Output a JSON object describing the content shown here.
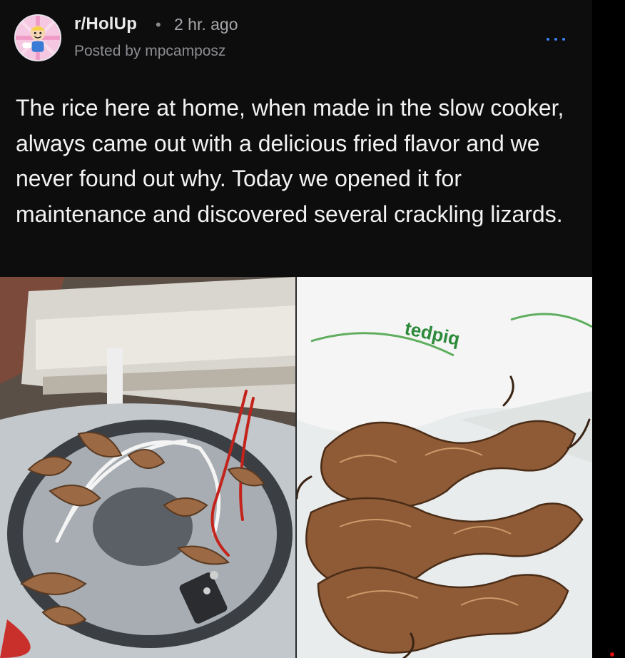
{
  "post": {
    "subreddit": "r/HolUp",
    "separator": "•",
    "age": "2 hr. ago",
    "posted_by": "Posted by mpcamposz",
    "title": "The rice here at home, when made in the slow cooker, always came out with a delicious fried flavor and we never found out why. Today we opened it for maintenance and discovered several crackling lizards.",
    "more_icon": "more-options-icon",
    "avatar_icon": "subreddit-avatar-icon"
  },
  "images": {
    "left": {
      "icon": "slow-cooker-interior-photo"
    },
    "right": {
      "icon": "dried-lizards-on-bag-photo",
      "bag_text": "tedpiq"
    }
  },
  "colors": {
    "background": "#0d0d0e",
    "text_primary": "#f2f2f3",
    "text_secondary": "#8c8d90",
    "accent": "#3b82f6"
  }
}
